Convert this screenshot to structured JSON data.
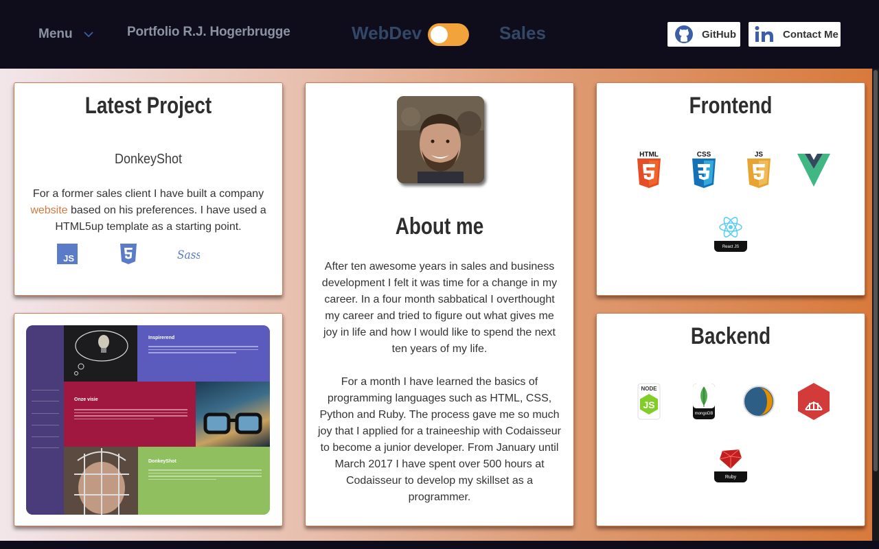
{
  "navbar": {
    "menu_label": "Menu",
    "site_title": "Portfolio R.J. Hogerbrugge",
    "mode_left": "WebDev",
    "mode_right": "Sales",
    "github_label": "GitHub",
    "contact_label": "Contact Me",
    "toggle_color": "#f2a33b"
  },
  "latest": {
    "title": "Latest Project",
    "project_name": "DonkeyShot",
    "desc_before": "For a former sales client I have built a company ",
    "desc_link": "website",
    "desc_after": " based on his preferences. I have used a HTML5up template as a starting point.",
    "tech_icons": [
      "js-icon",
      "html5-icon",
      "sass-icon"
    ],
    "tech_js": "JS",
    "tech_sass": "Sass"
  },
  "preview": {
    "heading_1": "Inspirerend",
    "heading_2": "Onze visie",
    "heading_3": "DonkeyShot"
  },
  "about": {
    "title": "About me",
    "para_1": "After ten awesome years in sales and business development I felt it was time for a change in my career. In a four month sabbatical I overthought my career and tried to figure out what gives me joy in life and how I would like to spend the next ten years of my life.",
    "para_2": "For a month I have learned the basics of programming languages such as HTML, CSS, Python and Ruby. The process gave me so much joy that I applied for a traineeship with Codaisseur to become a junior developer. From January until March 2017 I have spent over 500 hours at Codaisseur to develop my skillset as a programmer."
  },
  "frontend": {
    "title": "Frontend",
    "html_label": "HTML",
    "css_label": "CSS",
    "js_label": "JS",
    "react_label": "React JS"
  },
  "backend": {
    "title": "Backend",
    "node_label": "NODE",
    "mongo_label": "mongoDB",
    "ruby_label": "Ruby"
  },
  "colors": {
    "accent": "#d2783e",
    "navbar_bg": "#0f0d1b",
    "card_border": "#d2784c"
  }
}
